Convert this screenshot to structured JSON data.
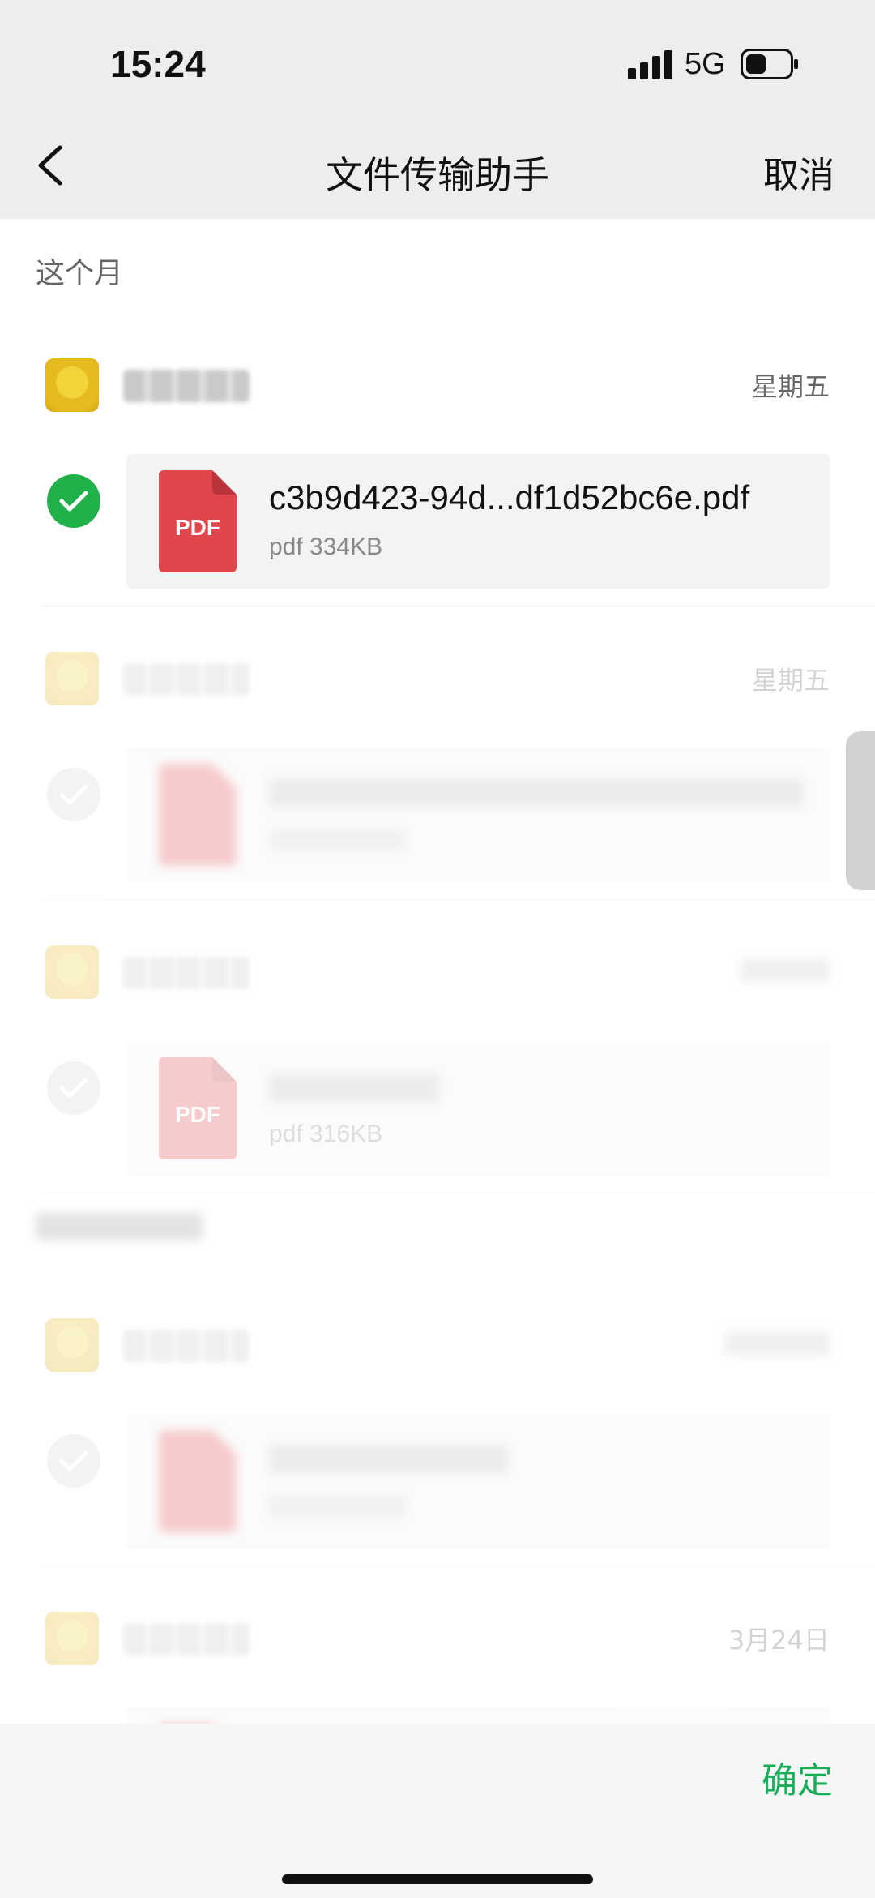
{
  "status_bar": {
    "time": "15:24",
    "network": "5G"
  },
  "nav": {
    "title": "文件传输助手",
    "cancel_label": "取消"
  },
  "sections": [
    {
      "label": "这个月"
    }
  ],
  "messages": [
    {
      "date": "星期五",
      "selected": true,
      "file_name": "c3b9d423-94d...df1d52bc6e.pdf",
      "file_meta": "pdf 334KB",
      "icon_text": "PDF"
    },
    {
      "date": "星期五",
      "selected": false,
      "file_name": "",
      "file_meta": "",
      "icon_text": ""
    },
    {
      "date": "",
      "selected": false,
      "file_name": "",
      "file_meta": "pdf 316KB",
      "icon_text": "PDF"
    },
    {
      "date": "",
      "selected": false,
      "file_name": "",
      "file_meta": "",
      "icon_text": ""
    },
    {
      "date": "3月24日",
      "selected": false,
      "file_name": "",
      "file_meta": "",
      "icon_text": ""
    }
  ],
  "footer": {
    "confirm_label": "确定"
  },
  "colors": {
    "accent_green": "#21b14a",
    "confirm_green": "#1aad5a",
    "pdf_red": "#e0474c"
  }
}
